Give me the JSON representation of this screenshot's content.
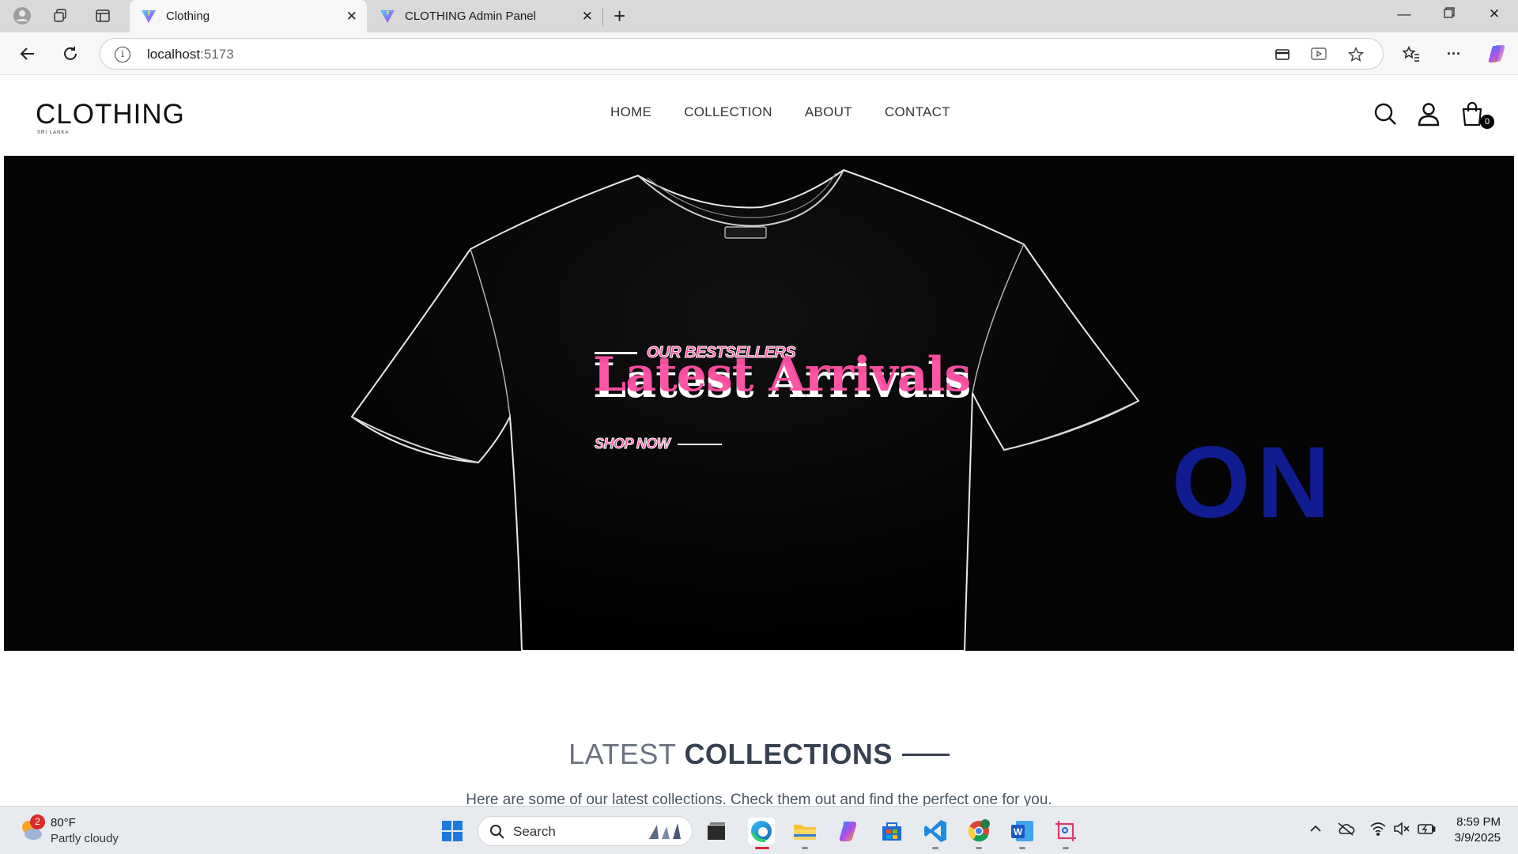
{
  "browser": {
    "tabs": [
      {
        "title": "Clothing",
        "active": true
      },
      {
        "title": "CLOTHING Admin Panel",
        "active": false
      }
    ],
    "address": {
      "host": "localhost",
      "port": ":5173"
    }
  },
  "site": {
    "logo": "CLOTHING",
    "logo_sub": "SRI LANKA",
    "nav": [
      "HOME",
      "COLLECTION",
      "ABOUT",
      "CONTACT"
    ],
    "cart_count": "0"
  },
  "hero": {
    "tagline": "OUR BESTSELLERS",
    "title": "Latest Arrivals",
    "cta": "SHOP NOW",
    "ghost_text": "ON"
  },
  "latest": {
    "title_light": "LATEST",
    "title_bold": "COLLECTIONS",
    "subtitle": "Here are some of our latest collections. Check them out and find the perfect one for you."
  },
  "taskbar": {
    "weather_badge": "2",
    "temperature": "80°F",
    "condition": "Partly cloudy",
    "search_placeholder": "Search",
    "time": "8:59 PM",
    "date": "3/9/2025"
  },
  "colors": {
    "accent_pink": "#ff4fa3",
    "hero_bg": "#050505",
    "ghost_blue": "#1221a8"
  }
}
